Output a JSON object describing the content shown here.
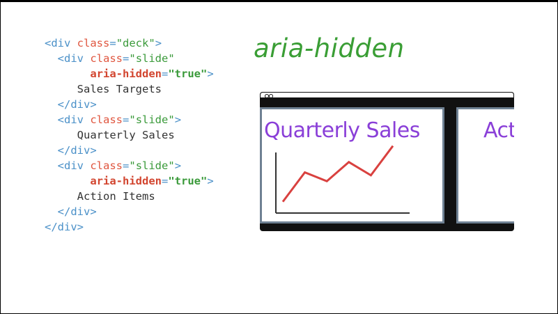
{
  "title": "aria-hidden",
  "code": {
    "lines": [
      {
        "indent": "",
        "parts": [
          [
            "tag",
            "<div "
          ],
          [
            "attr",
            "class"
          ],
          [
            "tag",
            "="
          ],
          [
            "str",
            "\"deck\""
          ],
          [
            "tag",
            ">"
          ]
        ]
      },
      {
        "indent": "  ",
        "parts": [
          [
            "tag",
            "<div "
          ],
          [
            "attr",
            "class"
          ],
          [
            "tag",
            "="
          ],
          [
            "str",
            "\"slide\""
          ]
        ]
      },
      {
        "indent": "       ",
        "parts": [
          [
            "battr",
            "aria-hidden"
          ],
          [
            "tag",
            "="
          ],
          [
            "bval",
            "\"true\""
          ],
          [
            "tag",
            ">"
          ]
        ]
      },
      {
        "indent": "     ",
        "parts": [
          [
            "txt",
            "Sales Targets"
          ]
        ]
      },
      {
        "indent": "  ",
        "parts": [
          [
            "tag",
            "</div>"
          ]
        ]
      },
      {
        "indent": "  ",
        "parts": [
          [
            "tag",
            "<div "
          ],
          [
            "attr",
            "class"
          ],
          [
            "tag",
            "="
          ],
          [
            "str",
            "\"slide\""
          ],
          [
            "tag",
            ">"
          ]
        ]
      },
      {
        "indent": "     ",
        "parts": [
          [
            "txt",
            "Quarterly Sales"
          ]
        ]
      },
      {
        "indent": "  ",
        "parts": [
          [
            "tag",
            "</div>"
          ]
        ]
      },
      {
        "indent": "  ",
        "parts": [
          [
            "tag",
            "<div "
          ],
          [
            "attr",
            "class"
          ],
          [
            "tag",
            "="
          ],
          [
            "str",
            "\"slide\""
          ],
          [
            "tag",
            ">"
          ]
        ]
      },
      {
        "indent": "       ",
        "parts": [
          [
            "battr",
            "aria-hidden"
          ],
          [
            "tag",
            "="
          ],
          [
            "bval",
            "\"true\""
          ],
          [
            "tag",
            ">"
          ]
        ]
      },
      {
        "indent": "     ",
        "parts": [
          [
            "txt",
            "Action Items"
          ]
        ]
      },
      {
        "indent": "  ",
        "parts": [
          [
            "tag",
            "</div>"
          ]
        ]
      },
      {
        "indent": "",
        "parts": [
          [
            "tag",
            "</div>"
          ]
        ]
      }
    ]
  },
  "browser": {
    "slide1_title": "Quarterly Sales",
    "slide2_title": "Act"
  },
  "chart_data": {
    "type": "line",
    "x": [
      1,
      2,
      3,
      4,
      5,
      6
    ],
    "values": [
      2,
      22,
      16,
      29,
      20,
      40
    ],
    "ylim": [
      0,
      45
    ],
    "color": "#d9413f"
  }
}
